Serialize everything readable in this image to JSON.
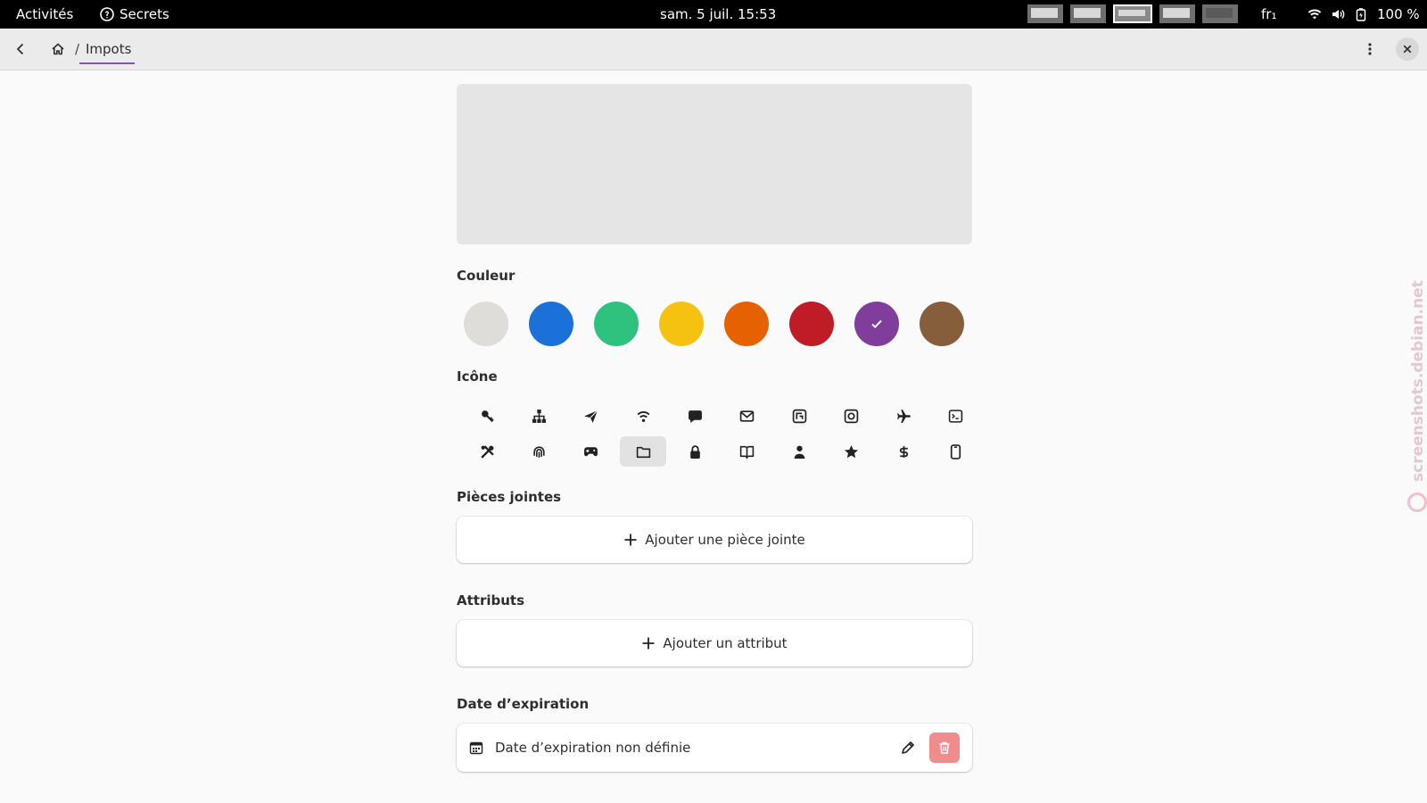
{
  "topbar": {
    "activities": "Activités",
    "app_name": "Secrets",
    "clock": "sam. 5 juil.  15:53",
    "language": "fr₁",
    "battery": "100 %"
  },
  "header": {
    "breadcrumb_separator": "/",
    "breadcrumb_current": "Impots"
  },
  "sections": {
    "color": "Couleur",
    "icon": "Icône",
    "attachments": "Pièces jointes",
    "attributes": "Attributs",
    "expiry": "Date d’expiration"
  },
  "colors": [
    {
      "name": "grey",
      "hex": "#deddda",
      "selected": false
    },
    {
      "name": "blue",
      "hex": "#1c71d8",
      "selected": false
    },
    {
      "name": "green",
      "hex": "#2ec27e",
      "selected": false
    },
    {
      "name": "yellow",
      "hex": "#f5c211",
      "selected": false
    },
    {
      "name": "orange",
      "hex": "#e66100",
      "selected": false
    },
    {
      "name": "red",
      "hex": "#c01c28",
      "selected": false
    },
    {
      "name": "purple",
      "hex": "#813d9c",
      "selected": true
    },
    {
      "name": "brown",
      "hex": "#865e3c",
      "selected": false
    }
  ],
  "icons": [
    "key-icon",
    "network-icon",
    "paper-plane-icon",
    "wifi-icon",
    "chat-icon",
    "mail-icon",
    "nfc-icon",
    "safe-icon",
    "plane-icon",
    "terminal-icon",
    "tools-icon",
    "fingerprint-icon",
    "gamepad-icon",
    "folder-icon",
    "lock-icon",
    "book-icon",
    "person-icon",
    "star-icon",
    "dollar-icon",
    "phone-icon"
  ],
  "selected_icon": "folder-icon",
  "attachments": {
    "add_label": "Ajouter une pièce jointe"
  },
  "attributes": {
    "add_label": "Ajouter un attribut"
  },
  "expiry": {
    "value_label": "Date d’expiration non définie"
  },
  "watermark": "screenshots.debian.net"
}
